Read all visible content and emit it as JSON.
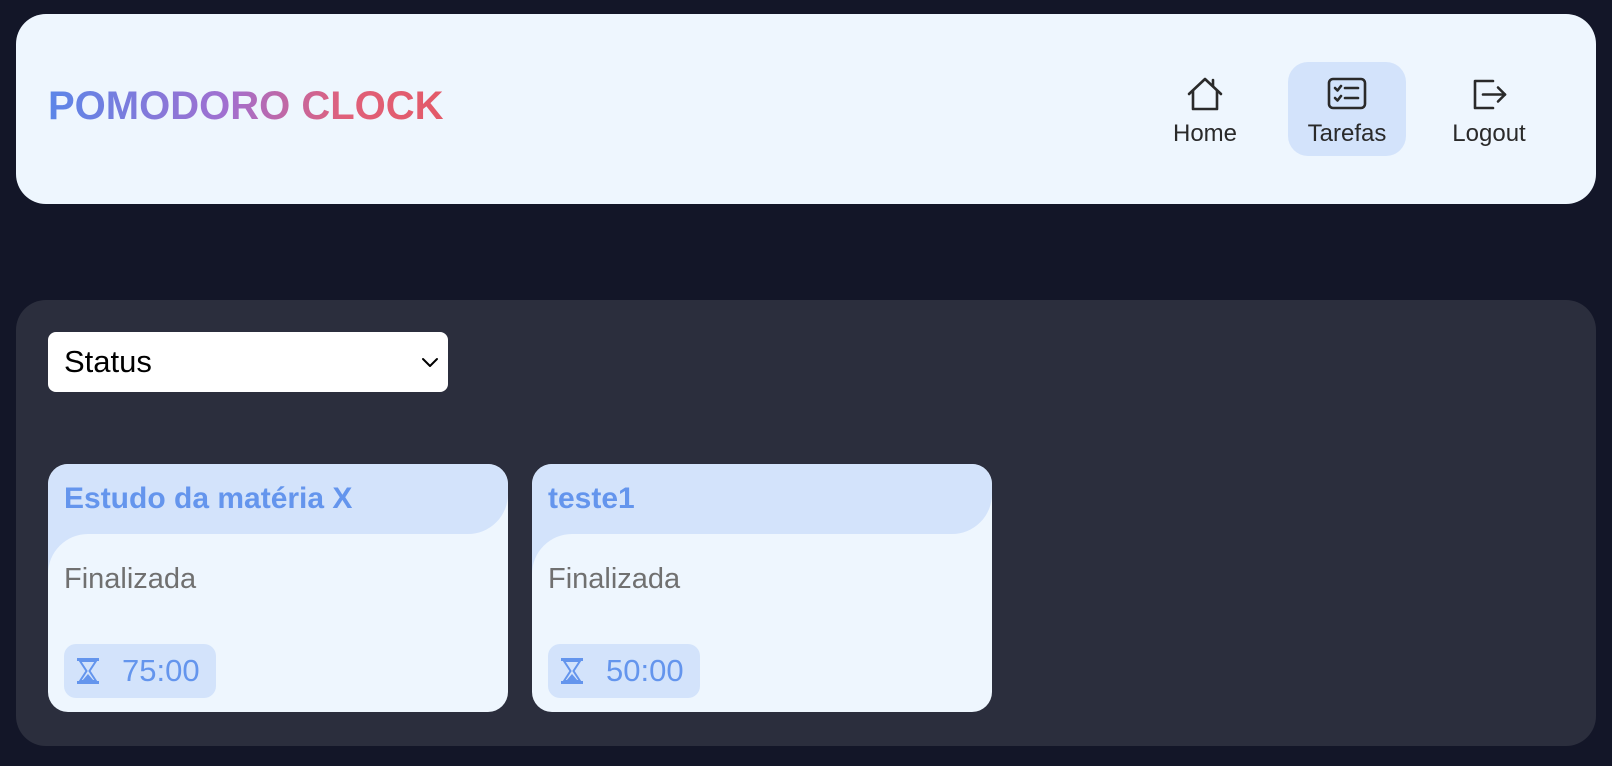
{
  "header": {
    "logo": "POMODORO CLOCK",
    "nav": [
      {
        "label": "Home",
        "icon": "house-icon",
        "active": false
      },
      {
        "label": "Tarefas",
        "icon": "checklist-icon",
        "active": true
      },
      {
        "label": "Logout",
        "icon": "logout-icon",
        "active": false
      }
    ]
  },
  "filter": {
    "selected": "Status"
  },
  "tasks": [
    {
      "title": "Estudo da matéria X",
      "status": "Finalizada",
      "time": "75:00"
    },
    {
      "title": "teste1",
      "status": "Finalizada",
      "time": "50:00"
    }
  ],
  "colors": {
    "background": "#131628",
    "panel": "#2b2e3d",
    "header_bg": "#eef6fe",
    "accent": "#6495ed",
    "accent_light": "#d3e3fb"
  }
}
